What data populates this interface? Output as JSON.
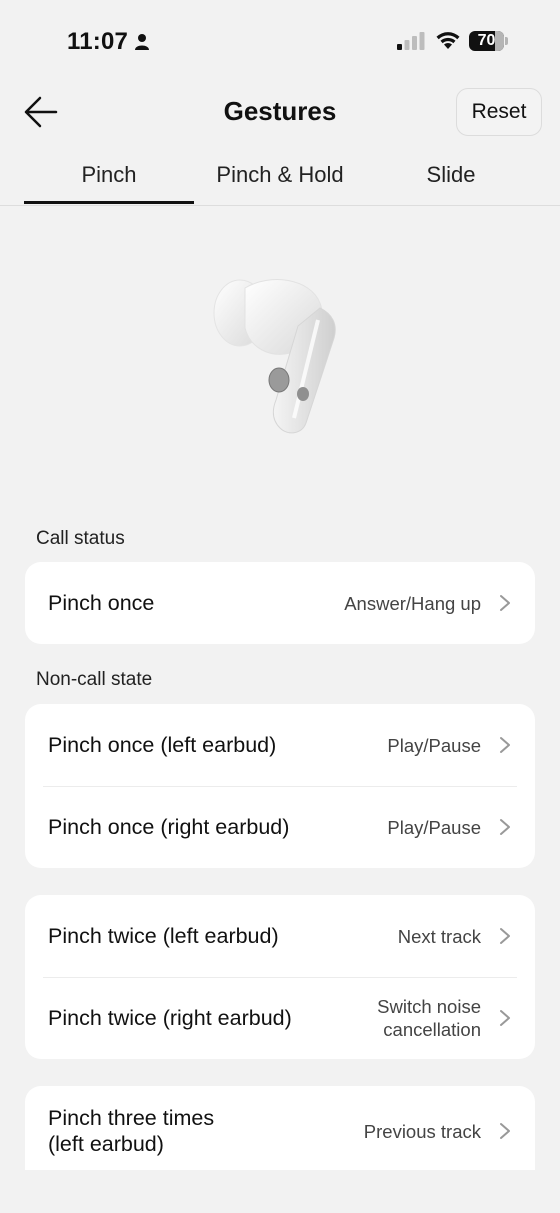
{
  "status_bar": {
    "time": "11:07",
    "battery_level": "70"
  },
  "header": {
    "title": "Gestures",
    "reset_label": "Reset"
  },
  "tabs": [
    {
      "label": "Pinch",
      "active": true
    },
    {
      "label": "Pinch & Hold",
      "active": false
    },
    {
      "label": "Slide",
      "active": false
    }
  ],
  "sections": {
    "call_status": {
      "label": "Call status",
      "rows": [
        {
          "label": "Pinch once",
          "value": "Answer/Hang up"
        }
      ]
    },
    "non_call": {
      "label": "Non-call state",
      "group1": [
        {
          "label": "Pinch once (left earbud)",
          "value": "Play/Pause"
        },
        {
          "label": "Pinch once (right earbud)",
          "value": "Play/Pause"
        }
      ],
      "group2": [
        {
          "label": "Pinch twice (left earbud)",
          "value": "Next track"
        },
        {
          "label": "Pinch twice (right earbud)",
          "value_line1": "Switch noise",
          "value_line2": "cancellation"
        }
      ],
      "group3": [
        {
          "label_line1": "Pinch three times",
          "label_line2": "(left earbud)",
          "value": "Previous track"
        }
      ]
    }
  },
  "colors": {
    "background": "#f2f2f2",
    "card": "#ffffff",
    "text": "#111111",
    "secondary_text": "#444444",
    "active_tab_underline": "#111111"
  },
  "icons": [
    "person-icon",
    "signal-icon",
    "wifi-icon",
    "battery-icon",
    "back-arrow-icon",
    "chevron-right-icon",
    "earbud-image"
  ]
}
